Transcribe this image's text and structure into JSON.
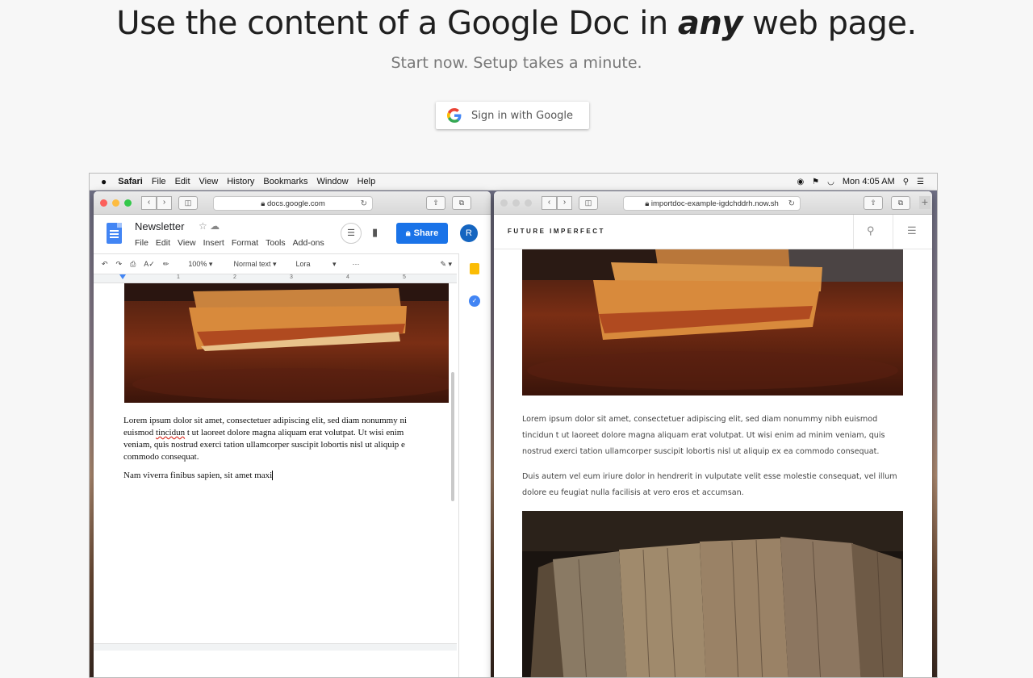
{
  "hero": {
    "title_before": "Use the content of a Google Doc in ",
    "title_emphasis": "any",
    "title_after": " web page.",
    "subtitle": "Start now. Setup takes a minute.",
    "signin_label": "Sign in with Google"
  },
  "menubar": {
    "apple": "",
    "items": [
      "Safari",
      "File",
      "Edit",
      "View",
      "History",
      "Bookmarks",
      "Window",
      "Help"
    ],
    "clock": "Mon 4:05 AM"
  },
  "left_window": {
    "url": "docs.google.com",
    "doc_title": "Newsletter",
    "menu": [
      "File",
      "Edit",
      "View",
      "Insert",
      "Format",
      "Tools",
      "Add-ons"
    ],
    "share_label": "Share",
    "avatar_letter": "R",
    "toolbar": {
      "zoom": "100%",
      "style": "Normal text",
      "font": "Lora"
    },
    "ruler_ticks": [
      "1",
      "2",
      "3",
      "4",
      "5"
    ],
    "para1_lines": [
      "Lorem ipsum dolor sit amet, consectetuer adipiscing elit, sed diam nonummy ni",
      "tincidun",
      " t ut laoreet dolore magna aliquam erat volutpat. Ut wisi enim",
      "veniam, quis nostrud exerci tation ullamcorper suscipit lobortis nisl ut aliquip e",
      "commodo consequat."
    ],
    "para1_line2_prefix": "euismod ",
    "para2": "Nam viverra finibus sapien, sit amet maxi"
  },
  "right_window": {
    "url": "importdoc-example-igdchddrh.now.sh",
    "brand": "FUTURE IMPERFECT",
    "para1": "Lorem ipsum dolor sit amet, consectetuer adipiscing elit, sed diam nonummy nibh euismod tincidun t ut laoreet dolore magna aliquam erat volutpat. Ut wisi enim ad minim veniam, quis nostrud exerci tation ullamcorper suscipit lobortis nisl ut aliquip ex ea commodo consequat.",
    "para2": "Duis autem vel eum iriure dolor in hendrerit in vulputate velit esse molestie consequat, vel illum dolore eu feugiat nulla facilisis at vero eros et accumsan."
  },
  "icons": [
    "google-g-icon",
    "apple-icon",
    "back-icon",
    "forward-icon",
    "sidebar-icon",
    "lock-icon",
    "reload-icon",
    "share-sheet-icon",
    "tabs-icon",
    "star-icon",
    "cloud-icon",
    "comment-icon",
    "lock-share-icon",
    "undo-icon",
    "redo-icon",
    "print-icon",
    "spellcheck-icon",
    "paint-format-icon",
    "pencil-icon",
    "keep-icon",
    "tasks-icon",
    "search-icon",
    "hamburger-icon"
  ]
}
